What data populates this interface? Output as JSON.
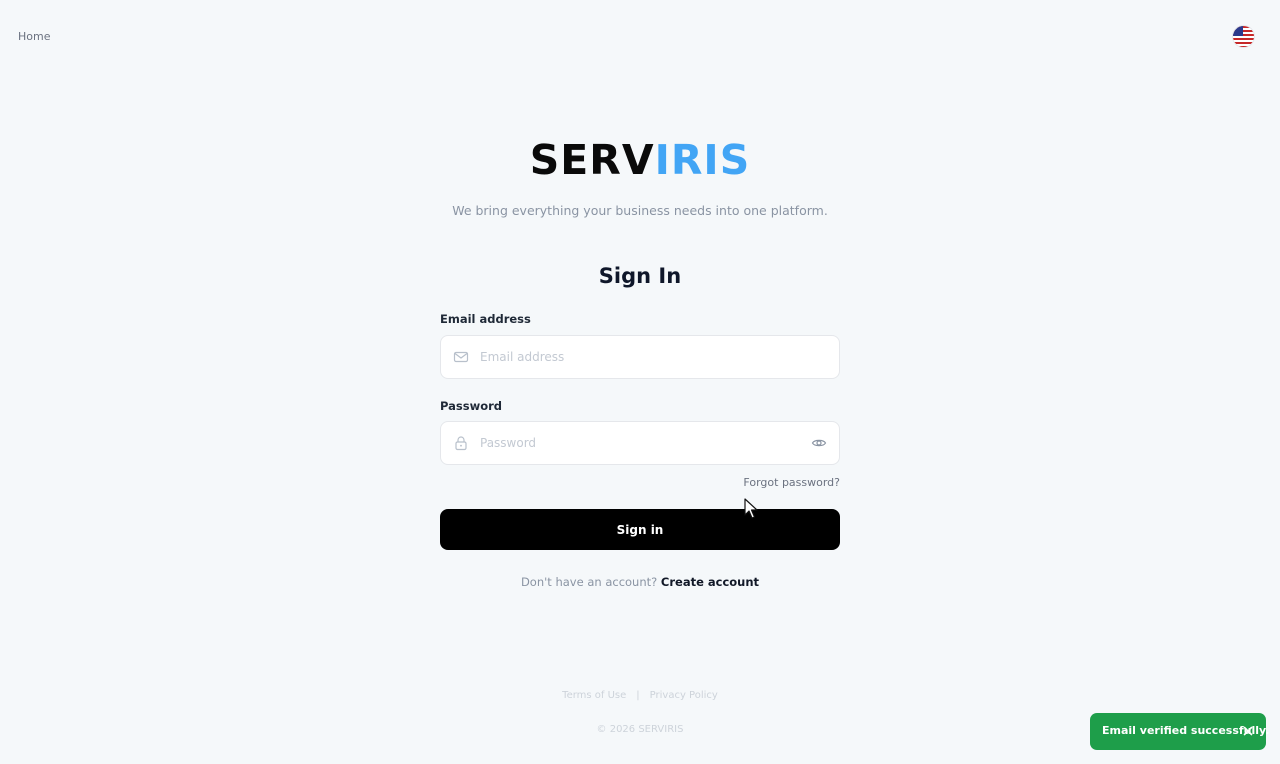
{
  "nav": {
    "home_label": "Home"
  },
  "brand": {
    "name_part1": "SERV",
    "name_part2": "IRIS",
    "accent_color": "#42a5f5"
  },
  "tagline": "We bring everything your business needs into one platform.",
  "form": {
    "title": "Sign In",
    "email": {
      "label": "Email address",
      "placeholder": "Email address",
      "value": "",
      "icon": "mail-icon"
    },
    "password": {
      "label": "Password",
      "placeholder": "Password",
      "value": "",
      "icon": "lock-icon",
      "toggle_icon": "eye-icon"
    },
    "forgot_label": "Forgot password?",
    "submit_label": "Sign in",
    "signup_prompt": "Don't have an account?",
    "signup_link": "Create account"
  },
  "footer": {
    "terms": "Terms of Use",
    "separator": "|",
    "privacy": "Privacy Policy",
    "copyright": "© 2026 SERVIRIS"
  },
  "toast": {
    "message": "Email verified successfully.",
    "color": "#1e9e4a",
    "close_icon": "close-icon"
  },
  "language": {
    "icon": "us-flag-icon"
  }
}
